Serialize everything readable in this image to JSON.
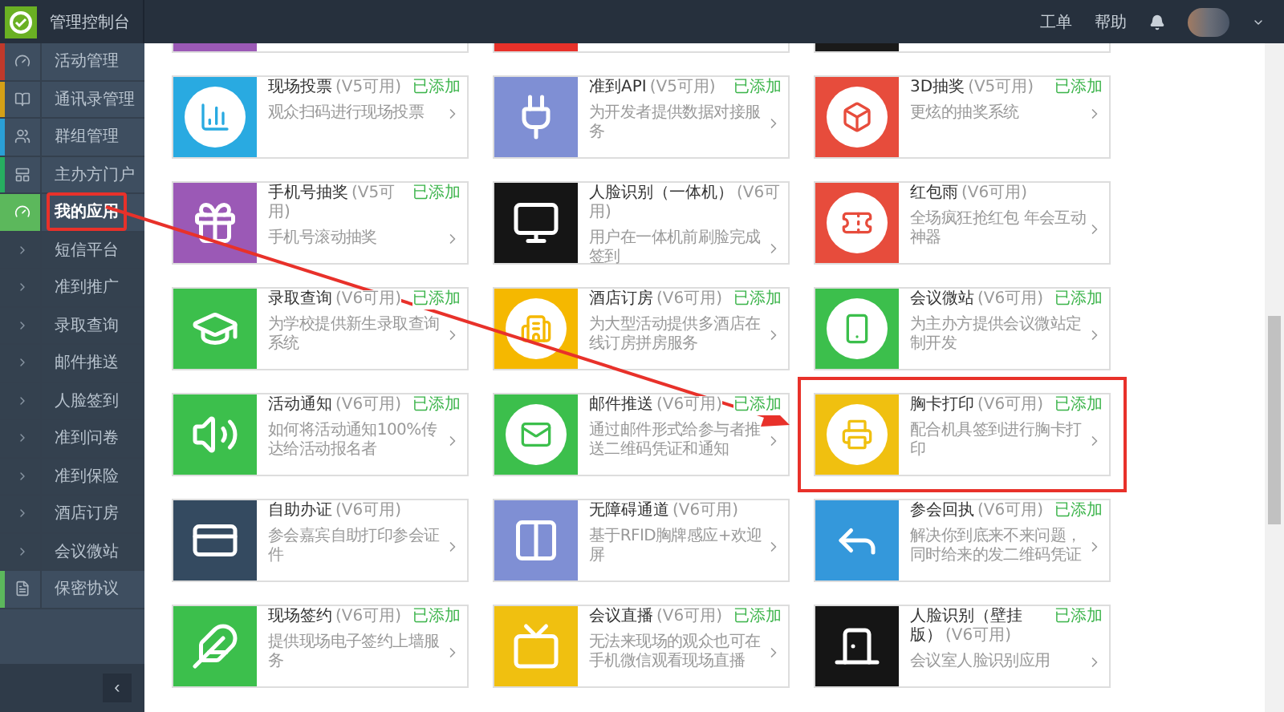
{
  "header": {
    "title": "管理控制台",
    "links": [
      "工单",
      "帮助"
    ]
  },
  "sidebar": {
    "items": [
      {
        "kind": "section",
        "label": "活动管理",
        "color": "#c0392b",
        "selected": false,
        "highlighted": false
      },
      {
        "kind": "section",
        "label": "通讯录管理",
        "color": "#d4a017",
        "selected": false,
        "highlighted": false
      },
      {
        "kind": "section",
        "label": "群组管理",
        "color": "#2a9fd6",
        "selected": false,
        "highlighted": false
      },
      {
        "kind": "section",
        "label": "主办方门户",
        "color": "#27ae60",
        "selected": false,
        "highlighted": false
      },
      {
        "kind": "section",
        "label": "我的应用",
        "color": "#5cb85c",
        "selected": true,
        "highlighted": true
      },
      {
        "kind": "sub",
        "label": "短信平台",
        "selected": false,
        "highlighted": false
      },
      {
        "kind": "sub",
        "label": "准到推广",
        "selected": false,
        "highlighted": false
      },
      {
        "kind": "sub",
        "label": "录取查询",
        "selected": false,
        "highlighted": false
      },
      {
        "kind": "sub",
        "label": "邮件推送",
        "selected": false,
        "highlighted": false
      },
      {
        "kind": "sub",
        "label": "人脸签到",
        "selected": false,
        "highlighted": false
      },
      {
        "kind": "sub",
        "label": "准到问卷",
        "selected": false,
        "highlighted": false
      },
      {
        "kind": "sub",
        "label": "准到保险",
        "selected": false,
        "highlighted": false
      },
      {
        "kind": "sub",
        "label": "酒店订房",
        "selected": false,
        "highlighted": false
      },
      {
        "kind": "sub",
        "label": "会议微站",
        "selected": false,
        "highlighted": false
      },
      {
        "kind": "section",
        "label": "保密协议",
        "color": "#5cb85c",
        "selected": false,
        "highlighted": false
      }
    ],
    "collapse": "‹"
  },
  "partial_cards": [
    {
      "color": "#9b59b6"
    },
    {
      "color": "#e8312a"
    },
    {
      "color": "#1a1a1a"
    }
  ],
  "cards": [
    {
      "title": "现场投票",
      "version": "(V5可用)",
      "desc": "观众扫码进行现场投票",
      "status": "已添加",
      "color": "#29aae1",
      "highlighted": false
    },
    {
      "title": "准到API",
      "version": "(V5可用)",
      "desc": "为开发者提供数据对接服务",
      "status": "已添加",
      "color": "#7f8fd4",
      "highlighted": false
    },
    {
      "title": "3D抽奖",
      "version": "(V5可用)",
      "desc": "更炫的抽奖系统",
      "status": "已添加",
      "color": "#e74c3c",
      "highlighted": false
    },
    {
      "title": "手机号抽奖",
      "version": "(V5可用)",
      "desc": "手机号滚动抽奖",
      "status": "已添加",
      "color": "#9b59b6",
      "highlighted": false
    },
    {
      "title": "人脸识别（一体机）",
      "version": "(V6可用)",
      "desc": "用户在一体机前刷脸完成签到",
      "color": "#151515",
      "highlighted": false
    },
    {
      "title": "红包雨",
      "version": "(V6可用)",
      "desc": "全场疯狂抢红包 年会互动神器",
      "color": "#e74c3c",
      "highlighted": false
    },
    {
      "title": "录取查询",
      "version": "(V6可用)",
      "desc": "为学校提供新生录取查询系统",
      "status": "已添加",
      "color": "#3cbf4c",
      "highlighted": false
    },
    {
      "title": "酒店订房",
      "version": "(V6可用)",
      "desc": "为大型活动提供多酒店在线订房拼房服务",
      "status": "已添加",
      "color": "#f5b800",
      "highlighted": false
    },
    {
      "title": "会议微站",
      "version": "(V6可用)",
      "desc": "为主办方提供会议微站定制开发",
      "status": "已添加",
      "color": "#3cbf4c",
      "highlighted": false
    },
    {
      "title": "活动通知",
      "version": "(V6可用)",
      "desc": "如何将活动通知100%传达给活动报名者",
      "status": "已添加",
      "color": "#3cbf4c",
      "highlighted": false
    },
    {
      "title": "邮件推送",
      "version": "(V6可用)",
      "desc": "通过邮件形式给参与者推送二维码凭证和通知",
      "status": "已添加",
      "color": "#3cbf4c",
      "highlighted": false
    },
    {
      "title": "胸卡打印",
      "version": "(V6可用)",
      "desc": "配合机具签到进行胸卡打印",
      "status": "已添加",
      "color": "#f0c010",
      "highlighted": true
    },
    {
      "title": "自助办证",
      "version": "(V6可用)",
      "desc": "参会嘉宾自助打印参会证件",
      "color": "#344a60",
      "highlighted": false
    },
    {
      "title": "无障碍通道",
      "version": "(V6可用)",
      "desc": "基于RFID胸牌感应+欢迎屏",
      "color": "#7f8fd4",
      "highlighted": false
    },
    {
      "title": "参会回执",
      "version": "(V6可用)",
      "desc": "解决你到底来不来问题，同时给来的发二维码凭证",
      "status": "已添加",
      "color": "#3498db",
      "highlighted": false
    },
    {
      "title": "现场签约",
      "version": "(V6可用)",
      "desc": "提供现场电子签约上墙服务",
      "status": "已添加",
      "color": "#3cbf4c",
      "highlighted": false
    },
    {
      "title": "会议直播",
      "version": "(V6可用)",
      "desc": "无法来现场的观众也可在手机微信观看现场直播",
      "status": "已添加",
      "color": "#f0c010",
      "highlighted": false
    },
    {
      "title": "人脸识别（壁挂版）",
      "version": "(V6可用)",
      "desc": "会议室人脸识别应用",
      "status": "已添加",
      "color": "#151515",
      "highlighted": false
    }
  ]
}
